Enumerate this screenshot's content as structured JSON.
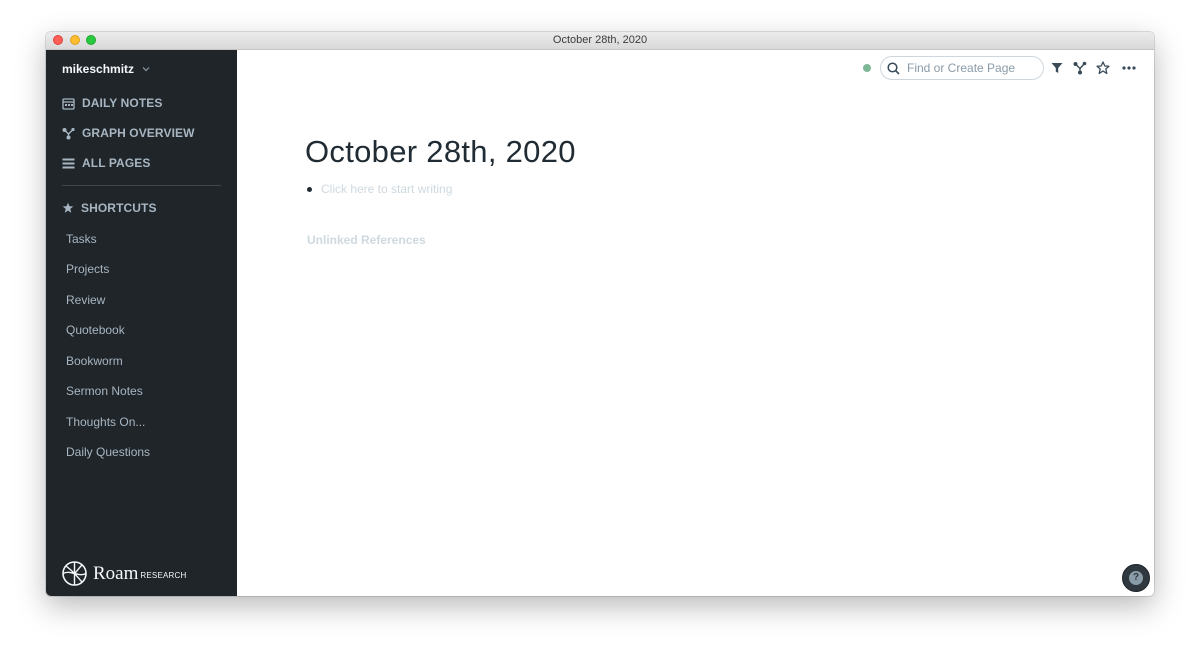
{
  "window": {
    "title": "October 28th, 2020"
  },
  "sidebar": {
    "workspace": "mikeschmitz",
    "nav": [
      {
        "label": "DAILY NOTES",
        "icon": "calendar-icon"
      },
      {
        "label": "GRAPH OVERVIEW",
        "icon": "graph-icon"
      },
      {
        "label": "ALL PAGES",
        "icon": "list-icon"
      }
    ],
    "shortcuts_header": "SHORTCUTS",
    "shortcuts": [
      "Tasks",
      "Projects",
      "Review",
      "Quotebook",
      "Bookworm",
      "Sermon Notes",
      "Thoughts On...",
      "Daily Questions"
    ],
    "logo": {
      "word": "Roam",
      "sub": "RESEARCH"
    }
  },
  "topbar": {
    "search_placeholder": "Find or Create Page",
    "sync_color": "#7eb796"
  },
  "page": {
    "title": "October 28th, 2020",
    "block_placeholder": "Click here to start writing",
    "unlinked_references": "Unlinked References"
  },
  "help": {
    "label": "?"
  },
  "colors": {
    "sidebar_bg": "#202529",
    "accent": "#7eb796"
  }
}
